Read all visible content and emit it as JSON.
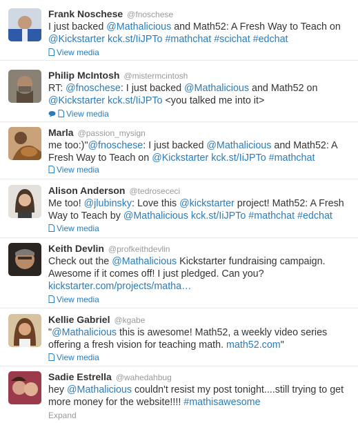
{
  "tweets": [
    {
      "name": "Frank Noschese",
      "handle": "@fnoschese",
      "text": [
        "I just backed ",
        {
          "l": "@Mathalicious"
        },
        " and Math52: A Fresh Way to Teach on ",
        {
          "l": "@Kickstarter"
        },
        " ",
        {
          "l": "kck.st/IiJPTo"
        },
        " ",
        {
          "l": "#mathchat"
        },
        " ",
        {
          "l": "#scichat"
        },
        " ",
        {
          "l": "#edchat"
        }
      ],
      "action": "View media"
    },
    {
      "name": "Philip McIntosh",
      "handle": "@mistermcintosh",
      "text": [
        "RT: ",
        {
          "l": "@fnoschese"
        },
        ": I just backed ",
        {
          "l": "@Mathalicious"
        },
        " and Math52 on ",
        {
          "l": "@Kickstarter"
        },
        " ",
        {
          "l": "kck.st/IiJPTo"
        },
        " <you talked me into it>"
      ],
      "action": "View media"
    },
    {
      "name": "Marla",
      "handle": "@passion_mysign",
      "text": [
        "me too:)\"",
        {
          "l": "@fnoschese"
        },
        ": I just backed ",
        {
          "l": "@Mathalicious"
        },
        " and Math52: A Fresh Way to Teach on ",
        {
          "l": "@Kickstarter"
        },
        " ",
        {
          "l": "kck.st/IiJPTo"
        },
        " ",
        {
          "l": "#mathchat"
        }
      ],
      "action": "View media"
    },
    {
      "name": "Alison Anderson",
      "handle": "@tedrosececi",
      "text": [
        "Me too! ",
        {
          "l": "@jlubinsky"
        },
        ": Love this ",
        {
          "l": "@kickstarter"
        },
        " project! Math52: A Fresh Way to Teach by ",
        {
          "l": "@Mathalicious"
        },
        " ",
        {
          "l": "kck.st/IiJPTo"
        },
        " ",
        {
          "l": "#mathchat"
        },
        " ",
        {
          "l": "#edchat"
        }
      ],
      "action": "View media"
    },
    {
      "name": "Keith Devlin",
      "handle": "@profkeithdevlin",
      "text": [
        "Check out the ",
        {
          "l": "@Mathalicious"
        },
        " Kickstarter fundraising campaign. Awesome if it comes off! I just pledged. Can you? ",
        {
          "l": "kickstarter.com/projects/matha…"
        }
      ],
      "action": "View media"
    },
    {
      "name": "Kellie Gabriel",
      "handle": "@kgabe",
      "text": [
        "\"",
        {
          "l": "@Mathalicious"
        },
        " this is awesome! Math52, a weekly video series offering a fresh vision for teaching math. ",
        {
          "l": "math52.com"
        },
        "\""
      ],
      "action": "View media"
    },
    {
      "name": "Sadie Estrella",
      "handle": "@wahedahbug",
      "text": [
        "hey ",
        {
          "l": "@Mathalicious"
        },
        " couldn't resist my post tonight....still trying to get more money for the website!!!! ",
        {
          "l": "#mathisawesome"
        }
      ],
      "action": "Expand"
    }
  ],
  "colors": {
    "link": "#2b7bb9",
    "name": "#333333",
    "muted": "#999999",
    "divider": "#e8e8e8"
  },
  "icons": [
    "photo-icon",
    "conversation-icon"
  ]
}
